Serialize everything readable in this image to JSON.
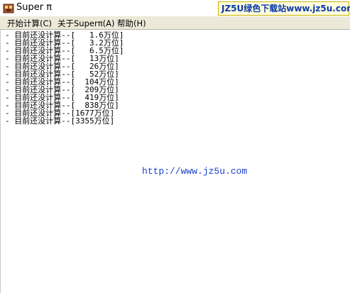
{
  "window": {
    "title": "Super π",
    "watermark": "JZ5U绿色下载站www.jz5u.com"
  },
  "menu": [
    {
      "label": "开始计算(C)"
    },
    {
      "label": "关于Superπ(A)"
    },
    {
      "label": "帮助(H)"
    }
  ],
  "output_lines": [
    "- 目前还没计算--[   1.6万位]",
    "- 目前还没计算--[   3.2万位]",
    "- 目前还没计算--[   6.5万位]",
    "- 目前还没计算--[   13万位]",
    "- 目前还没计算--[   26万位]",
    "- 目前还没计算--[   52万位]",
    "- 目前还没计算--[  104万位]",
    "- 目前还没计算--[  209万位]",
    "- 目前还没计算--[  419万位]",
    "- 目前还没计算--[  838万位]",
    "- 目前还没计算--[1677万位]",
    "- 目前还没计算--[3355万位]"
  ],
  "url_text": "http://www.jz5u.com",
  "colors": {
    "menubar": "#ece9d8",
    "url": "#1a3fd0",
    "watermark_text": "#0a3aa8"
  },
  "icons": {
    "app": "app-icon"
  }
}
